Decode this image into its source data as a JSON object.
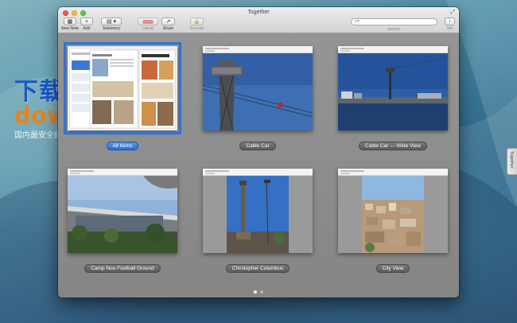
{
  "window": {
    "title": "Together"
  },
  "toolbar": {
    "new_note": "New Note",
    "add": "Add",
    "stationery": "Stationery",
    "labels": "Labels",
    "share": "Share",
    "encrypt": "Encrypt",
    "search_label": "Search",
    "info": "Info"
  },
  "search": {
    "placeholder": ""
  },
  "items": [
    {
      "caption": "All Items",
      "selected": true
    },
    {
      "caption": "Cable Car",
      "selected": false
    },
    {
      "caption": "Cable Car — Wide View",
      "selected": false
    },
    {
      "caption": "Camp Nou Football Ground",
      "selected": false
    },
    {
      "caption": "Christopher Columbus",
      "selected": false
    },
    {
      "caption": "City View",
      "selected": false
    }
  ],
  "pagination": {
    "pages": 2,
    "current": 1
  },
  "side_tab": {
    "label": "Together"
  },
  "watermark": {
    "chinese": "下载之家",
    "url": "downza.cn",
    "tagline": "国内最安全的软件下载站"
  },
  "colors": {
    "selection": "#2b74d9",
    "labels_red": "#e65a5a",
    "watermark_blue": "#1b57c8",
    "watermark_orange": "#e6841f"
  }
}
